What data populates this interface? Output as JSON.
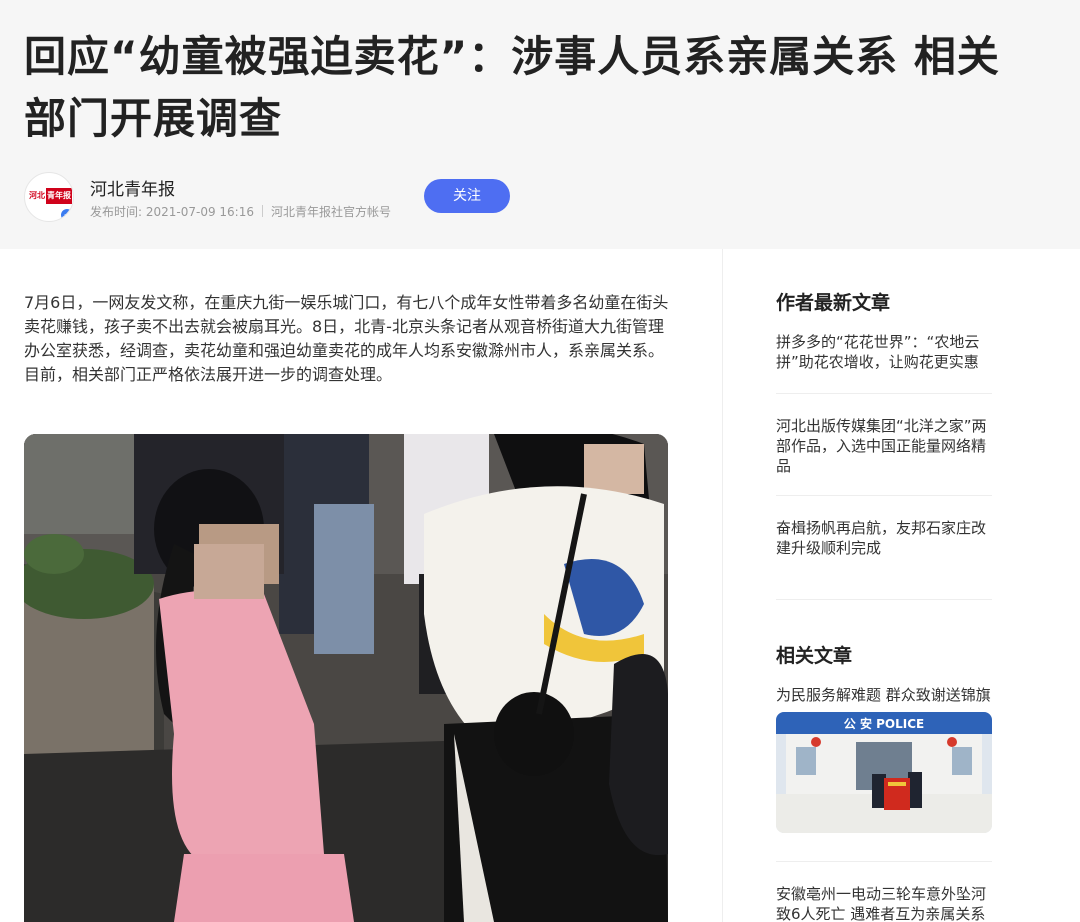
{
  "article": {
    "title": "回应“幼童被强迫卖花”：涉事人员系亲属关系 相关部门开展调查",
    "body": "7月6日，一网友发文称，在重庆九街一娱乐城门口，有七八个成年女性带着多名幼童在街头卖花赚钱，孩子卖不出去就会被扇耳光。8日，北青-北京头条记者从观音桥街道大九街管理办公室获悉，经调查，卖花幼童和强迫幼童卖花的成年人均系安徽滁州市人，系亲属关系。目前，相关部门正严格依法展开进一步的调查处理。"
  },
  "author": {
    "name": "河北青年报",
    "publish_time": "发布时间: 2021-07-09 16:16",
    "account_type": "河北青年报社官方帐号",
    "logo_text_a": "河北",
    "logo_text_b": "青年报",
    "verified_icon": "verified-check-icon",
    "follow_label": "关注"
  },
  "sidebar": {
    "latest_heading": "作者最新文章",
    "latest": [
      {
        "title": "拼多多的“花花世界”：“农地云拼”助花农增收，让购花更实惠"
      },
      {
        "title": "河北出版传媒集团“北洋之家”两部作品，入选中国正能量网络精品"
      },
      {
        "title": "奋楫扬帆再启航，友邦石家庄改建升级顺利完成"
      }
    ],
    "related_heading": "相关文章",
    "related": [
      {
        "title": "为民服务解难题 群众致谢送锦旗",
        "sign_text": "公 安 POLICE"
      },
      {
        "title": "安徽亳州一电动三轮车意外坠河致6人死亡 遇难者互为亲属关系"
      }
    ]
  },
  "colors": {
    "accent": "#4e6ef2",
    "header_bg": "#f6f6f6",
    "logo_red": "#d0021b",
    "verified_blue": "#3b7cf0"
  }
}
